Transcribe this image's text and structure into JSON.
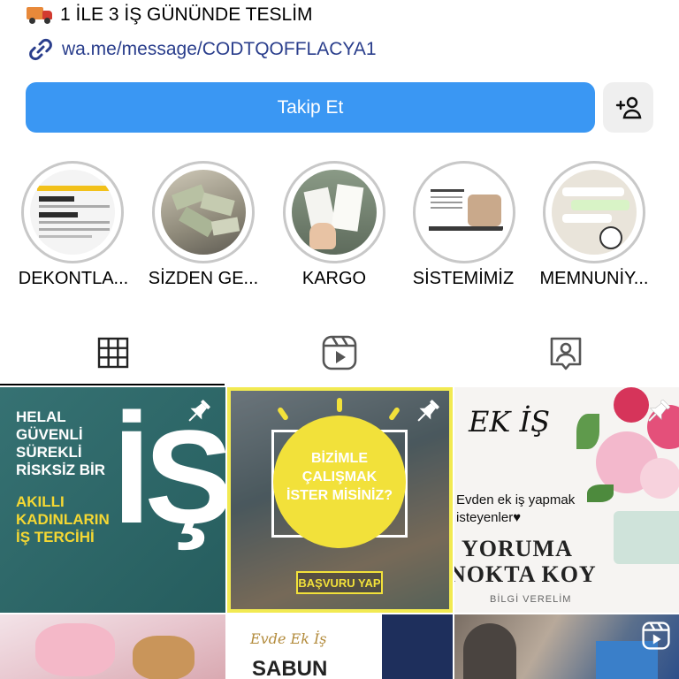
{
  "bio": {
    "delivery_text": "1 İLE 3 İŞ GÜNÜNDE TESLİM",
    "link_text": "wa.me/message/CODTQOFFLACYA1"
  },
  "actions": {
    "follow_label": "Takip Et"
  },
  "highlights": [
    {
      "label": "DEKONTLA..."
    },
    {
      "label": "SİZDEN GE..."
    },
    {
      "label": "KARGO"
    },
    {
      "label": "SİSTEMİMİZ"
    },
    {
      "label": "MEMNUNİY..."
    }
  ],
  "tabs": [
    "grid",
    "reels",
    "tagged"
  ],
  "posts": {
    "p1": {
      "lines": [
        "HELAL",
        "GÜVENLİ",
        "SÜREKLİ",
        "RİSKSİZ BİR"
      ],
      "yellow_lines": [
        "AKILLI",
        "KADINLARIN",
        "İŞ TERCİHİ"
      ],
      "big": "İŞ"
    },
    "p2": {
      "circle_lines": [
        "BİZİMLE",
        "ÇALIŞMAK",
        "İSTER MİSİNİZ?"
      ],
      "button": "BAŞVURU YAP"
    },
    "p3": {
      "title_script": "EK İŞ",
      "subtitle": "Evden ek iş yapmak isteyenler♥",
      "headline_1": "YORUMA",
      "headline_2": "NOKTA KOY",
      "footer": "BİLGİ VERELİM"
    },
    "p5": {
      "script": "Evde Ek İş",
      "word": "SABUN"
    }
  },
  "colors": {
    "follow_blue": "#3a97f3",
    "teal_post": "#2b6a6b",
    "yellow": "#f5e13a",
    "link_blue": "#2a3e8c"
  }
}
